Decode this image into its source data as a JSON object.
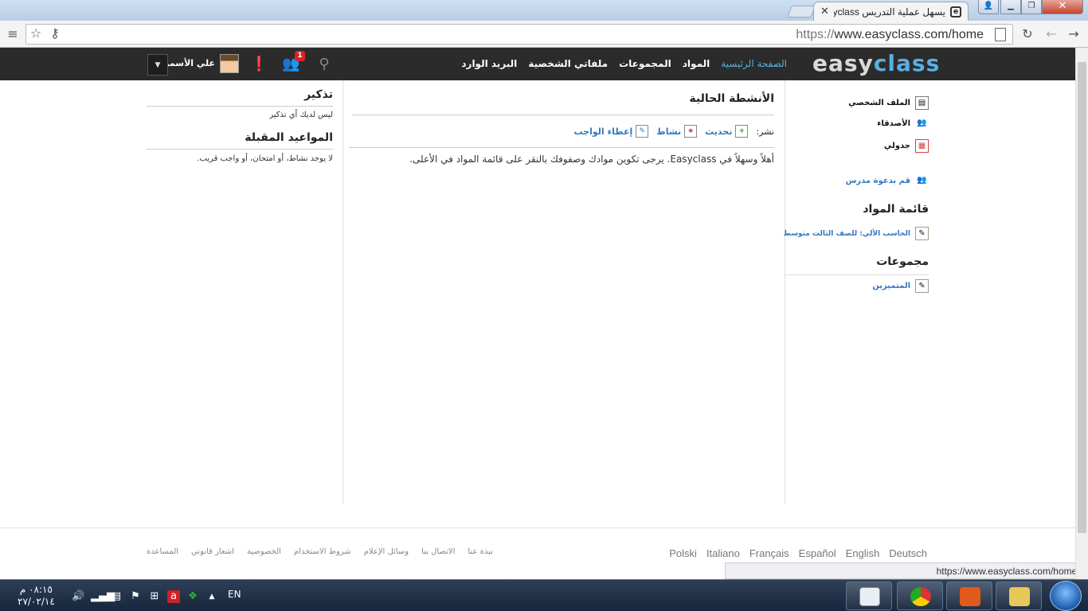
{
  "browser": {
    "tab_title": "يسهل عملية التدريس Easyclass",
    "tab_favicon": "e",
    "url_scheme": "https://",
    "url_host": "www.easyclass.com/home",
    "status_url": "https://www.easyclass.com/home#"
  },
  "site": {
    "logo_part1": "easy",
    "logo_part2": "class",
    "nav": {
      "home": "الصفحة الرئيسية",
      "courses": "المواد",
      "groups": "المجموعات",
      "files": "ملفاتي الشخصية",
      "inbox": "البريد الوارد"
    },
    "notif_count": "1",
    "username": "علي الأسمري"
  },
  "right_sidebar": {
    "profile": "الملف الشخصي",
    "friends": "الأصدقاء",
    "calendar": "جدولي",
    "invite_teacher": "قم بدعوة مدرس",
    "courses_heading": "قائمة المواد",
    "course_item": "الحاسب الألي: للصف الثالث متوسط",
    "groups_heading": "مجموعات",
    "group_item": "المتميزين"
  },
  "main": {
    "heading": "الأنشطة الحالية",
    "post_label": "نشر:",
    "post_update": "تحديث",
    "post_activity": "نشاط",
    "post_assignment": "إعطاء الواجب",
    "welcome": "أهلاً وسهلاً في Easyclass. يرجى تكوين موادك وصفوفك بالنقر على قائمة المواد في الأعلى."
  },
  "left_sidebar": {
    "reminder_heading": "تذكير",
    "reminder_text": "ليس لديك أي تذكير",
    "upcoming_heading": "المواعيد المقبلة",
    "upcoming_text": "لا يوجد نشاط، أو امتحان، أو واجب قريب."
  },
  "footer": {
    "links": [
      "نبذة عنا",
      "الاتصال بنا",
      "وسائل الإعلام",
      "شروط الاستخدام",
      "الخصوصية",
      "اشعار قانوني",
      "المساعدة"
    ],
    "languages": [
      "Polski",
      "Italiano",
      "Français",
      "Español",
      "English",
      "Deutsch"
    ]
  },
  "taskbar": {
    "time": "٠٨:١٥ م",
    "date": "٢٧/٠٢/١٤",
    "lang": "EN"
  },
  "colors": {
    "nav_bg": "#2b2b2b",
    "accent_blue": "#3478c0",
    "logo_blue": "#5aaee0"
  }
}
